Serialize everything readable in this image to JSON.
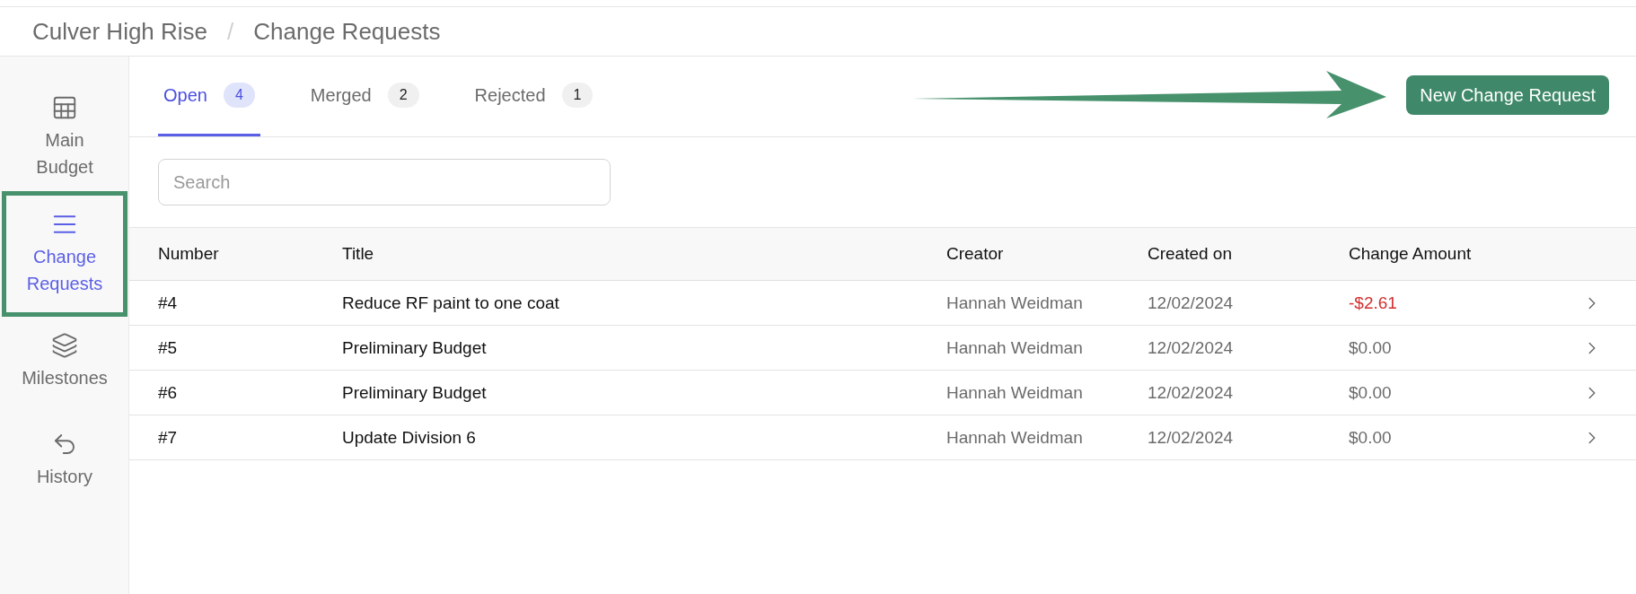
{
  "breadcrumb": {
    "project": "Culver High Rise",
    "separator": "/",
    "page": "Change Requests"
  },
  "sidebar": {
    "items": [
      {
        "kind": "table",
        "label": "Main Budget",
        "selected": false,
        "highlighted": false
      },
      {
        "kind": "list",
        "label": "Change Requests",
        "selected": true,
        "highlighted": true
      },
      {
        "kind": "layers",
        "label": "Milestones",
        "selected": false,
        "highlighted": false
      },
      {
        "kind": "history",
        "label": "History",
        "selected": false,
        "highlighted": false
      }
    ]
  },
  "tabs": [
    {
      "label": "Open",
      "count": "4",
      "selected": true
    },
    {
      "label": "Merged",
      "count": "2",
      "selected": false
    },
    {
      "label": "Rejected",
      "count": "1",
      "selected": false
    }
  ],
  "new_button": {
    "label": "New Change Request"
  },
  "search": {
    "placeholder": "Search"
  },
  "table": {
    "columns": [
      "Number",
      "Title",
      "Creator",
      "Created on",
      "Change Amount"
    ],
    "rows": [
      {
        "number": "#4",
        "title": "Reduce RF paint to one coat",
        "creator": "Hannah Weidman",
        "created_on": "12/02/2024",
        "amount": "-$2.61",
        "negative": true
      },
      {
        "number": "#5",
        "title": "Preliminary Budget",
        "creator": "Hannah Weidman",
        "created_on": "12/02/2024",
        "amount": "$0.00",
        "negative": false
      },
      {
        "number": "#6",
        "title": "Preliminary Budget",
        "creator": "Hannah Weidman",
        "created_on": "12/02/2024",
        "amount": "$0.00",
        "negative": false
      },
      {
        "number": "#7",
        "title": "Update Division 6",
        "creator": "Hannah Weidman",
        "created_on": "12/02/2024",
        "amount": "$0.00",
        "negative": false
      }
    ]
  }
}
